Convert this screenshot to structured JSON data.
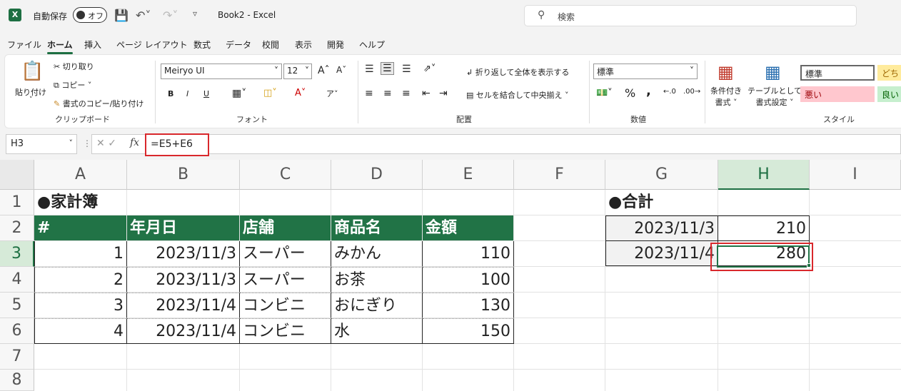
{
  "titlebar": {
    "app_icon": "X",
    "autosave_label": "自動保存",
    "toggle_label": "オフ",
    "doc_title": "Book2  -  Excel",
    "search_placeholder": "検索"
  },
  "tabs": [
    "ファイル",
    "ホーム",
    "挿入",
    "ページ レイアウト",
    "数式",
    "データ",
    "校閲",
    "表示",
    "開発",
    "ヘルプ"
  ],
  "ribbon": {
    "clipboard": {
      "paste": "貼り付け",
      "cut": "切り取り",
      "copy": "コピー",
      "format_painter": "書式のコピー/貼り付け",
      "group": "クリップボード"
    },
    "font": {
      "name": "Meiryo UI",
      "size": "12",
      "group": "フォント",
      "bold": "B",
      "italic": "I",
      "underline": "U"
    },
    "alignment": {
      "wrap": "折り返して全体を表示する",
      "merge": "セルを結合して中央揃え",
      "group": "配置"
    },
    "number": {
      "format": "標準",
      "group": "数値",
      "percent": "%",
      "comma": ","
    },
    "styles": {
      "cond": "条件付き",
      "cond2": "書式",
      "table": "テーブルとして",
      "table2": "書式設定",
      "group": "スタイル",
      "normal": "標準",
      "bad": "悪い",
      "neutral": "どち",
      "good": "良い"
    }
  },
  "formula_bar": {
    "name_box": "H3",
    "formula": "=E5+E6"
  },
  "columns": [
    "A",
    "B",
    "C",
    "D",
    "E",
    "F",
    "G",
    "H",
    "I"
  ],
  "rows": [
    "1",
    "2",
    "3",
    "4",
    "5",
    "6",
    "7",
    "8"
  ],
  "sheet": {
    "title": "●家計簿",
    "headers": [
      "#",
      "年月日",
      "店舗",
      "商品名",
      "金額"
    ],
    "data": [
      [
        "1",
        "2023/11/3",
        "スーパー",
        "みかん",
        "110"
      ],
      [
        "2",
        "2023/11/3",
        "スーパー",
        "お茶",
        "100"
      ],
      [
        "3",
        "2023/11/4",
        "コンビニ",
        "おにぎり",
        "130"
      ],
      [
        "4",
        "2023/11/4",
        "コンビニ",
        "水",
        "150"
      ]
    ],
    "summary_title": "●合計",
    "summary": [
      [
        "2023/11/3",
        "210"
      ],
      [
        "2023/11/4",
        "280"
      ]
    ]
  },
  "colors": {
    "excel_green": "#217346",
    "highlight_red": "#d9282c"
  }
}
